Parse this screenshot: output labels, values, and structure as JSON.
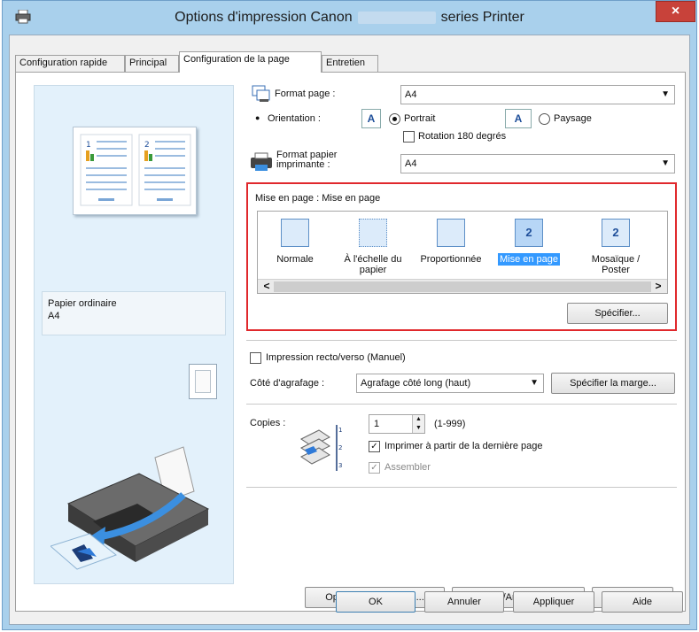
{
  "window": {
    "title_prefix": "Options d'impression Canon",
    "title_suffix": "series Printer",
    "close_label": "×"
  },
  "tabs": [
    "Configuration rapide",
    "Principal",
    "Configuration de la page",
    "Entretien"
  ],
  "preview": {
    "paper_type": "Papier ordinaire",
    "paper_size": "A4"
  },
  "page_size": {
    "label": "Format page :",
    "value": "A4"
  },
  "orientation": {
    "label": "Orientation :",
    "portrait": "Portrait",
    "landscape": "Paysage",
    "portrait_glyph": "A",
    "landscape_glyph": "A",
    "selected": "Portrait"
  },
  "rotate": {
    "label": "Rotation 180 degrés",
    "checked": false
  },
  "printer_paper": {
    "label_line1": "Format papier",
    "label_line2": "imprimante :",
    "value": "A4"
  },
  "layout": {
    "heading": "Mise en page : Mise en page",
    "items": [
      {
        "label_line1": "Normale",
        "label_line2": "",
        "glyph": ""
      },
      {
        "label_line1": "À l'échelle du",
        "label_line2": "papier",
        "glyph": ""
      },
      {
        "label_line1": "Proportionnée",
        "label_line2": "",
        "glyph": ""
      },
      {
        "label_line1": "Mise en page",
        "label_line2": "",
        "glyph": "2"
      },
      {
        "label_line1": "Mosaïque /",
        "label_line2": "Poster",
        "glyph": "2"
      }
    ],
    "selected": "Mise en page",
    "scroll_left": "<",
    "scroll_right": ">",
    "specify_button": "Spécifier..."
  },
  "duplex": {
    "label": "Impression recto/verso (Manuel)",
    "checked": false
  },
  "stapling": {
    "label": "Côté d'agrafage :",
    "value": "Agrafage côté long (haut)",
    "margin_button": "Spécifier la marge..."
  },
  "copies": {
    "label": "Copies :",
    "value": "1",
    "range": "(1-999)",
    "reverse_label": "Imprimer à partir de la dernière page",
    "reverse_checked": true,
    "collate_label": "Assembler",
    "collate_checked": true,
    "collate_disabled": true
  },
  "bottom_buttons": {
    "print_options": "Options d'impression...",
    "stamp_background": "Cachet/Arrière-plan...",
    "defaults": "Défaut"
  },
  "dialog_buttons": {
    "ok": "OK",
    "cancel": "Annuler",
    "apply": "Appliquer",
    "help": "Aide"
  },
  "colors": {
    "title_bar": "#a9d0ec",
    "close_button": "#c8423a",
    "highlight_border": "#e0282c",
    "selection": "#3399ff",
    "preview_bg": "#e3f1fb"
  }
}
